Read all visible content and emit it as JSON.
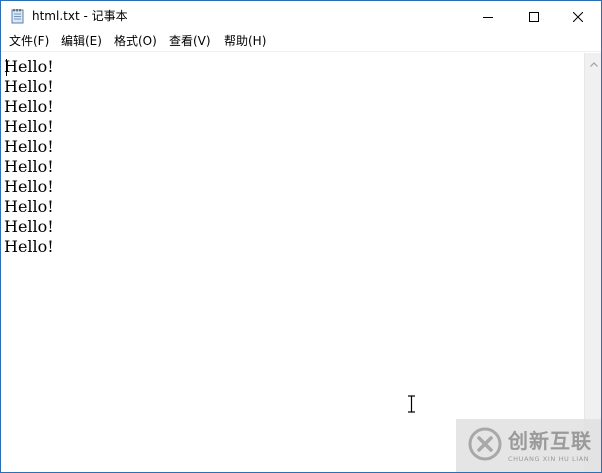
{
  "window": {
    "title": "html.txt - 记事本",
    "icon": "notepad-icon"
  },
  "controls": {
    "minimize_icon": "minimize-icon",
    "maximize_icon": "maximize-icon",
    "close_icon": "close-icon"
  },
  "menu": [
    {
      "label": "文件(F)"
    },
    {
      "label": "编辑(E)"
    },
    {
      "label": "格式(O)"
    },
    {
      "label": "查看(V)"
    },
    {
      "label": "帮助(H)"
    }
  ],
  "document": {
    "lines": [
      "Hello!",
      "Hello!",
      "Hello!",
      "Hello!",
      "Hello!",
      "Hello!",
      "Hello!",
      "Hello!",
      "Hello!",
      "Hello!"
    ]
  },
  "watermark": {
    "name_cn": "创新互联",
    "name_en": "CHUANG XIN HU LIAN"
  },
  "colors": {
    "window_border": "#2b6fb6",
    "menu_text": "#000000",
    "scrollbar_bg": "#f0f0f0",
    "watermark_text": "#9a9a9a"
  }
}
